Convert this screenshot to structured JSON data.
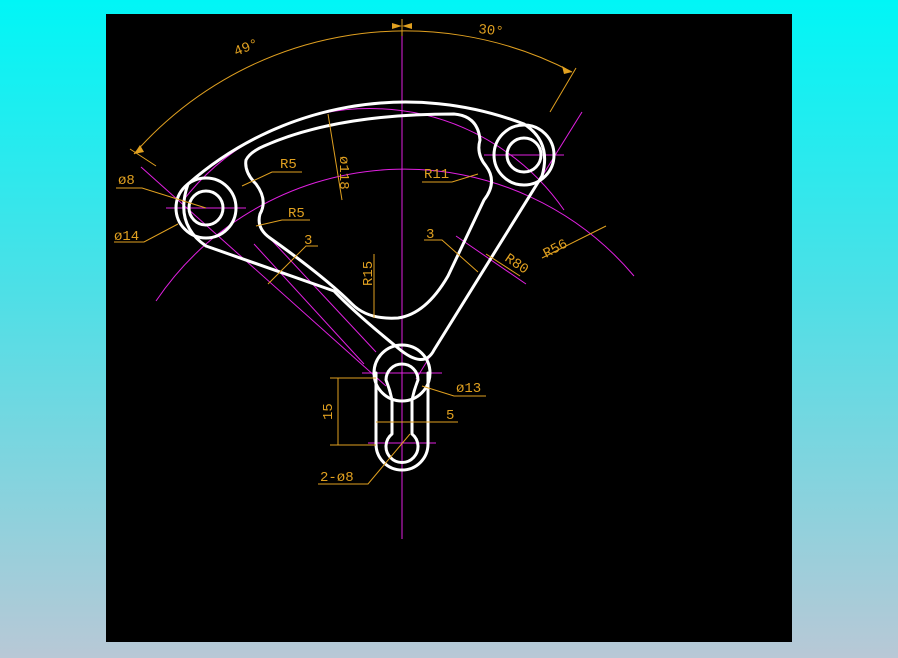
{
  "drawing": {
    "background_color": "#000000",
    "part_color": "#ffffff",
    "centerline_color": "#e020e0",
    "dimension_color": "#e0a020"
  },
  "dimensions": {
    "angle_left": "49°",
    "angle_right": "30°",
    "phi8": "ø8",
    "phi14": "ø14",
    "r5_top": "R5",
    "r5_bottom": "R5",
    "phi118": "ø118",
    "r11": "R11",
    "three_left": "3",
    "three_right": "3",
    "r15": "R15",
    "r80": "R80",
    "r56": "R56",
    "phi13": "ø13",
    "fifteen": "15",
    "five": "5",
    "two_phi8": "2-ø8"
  }
}
